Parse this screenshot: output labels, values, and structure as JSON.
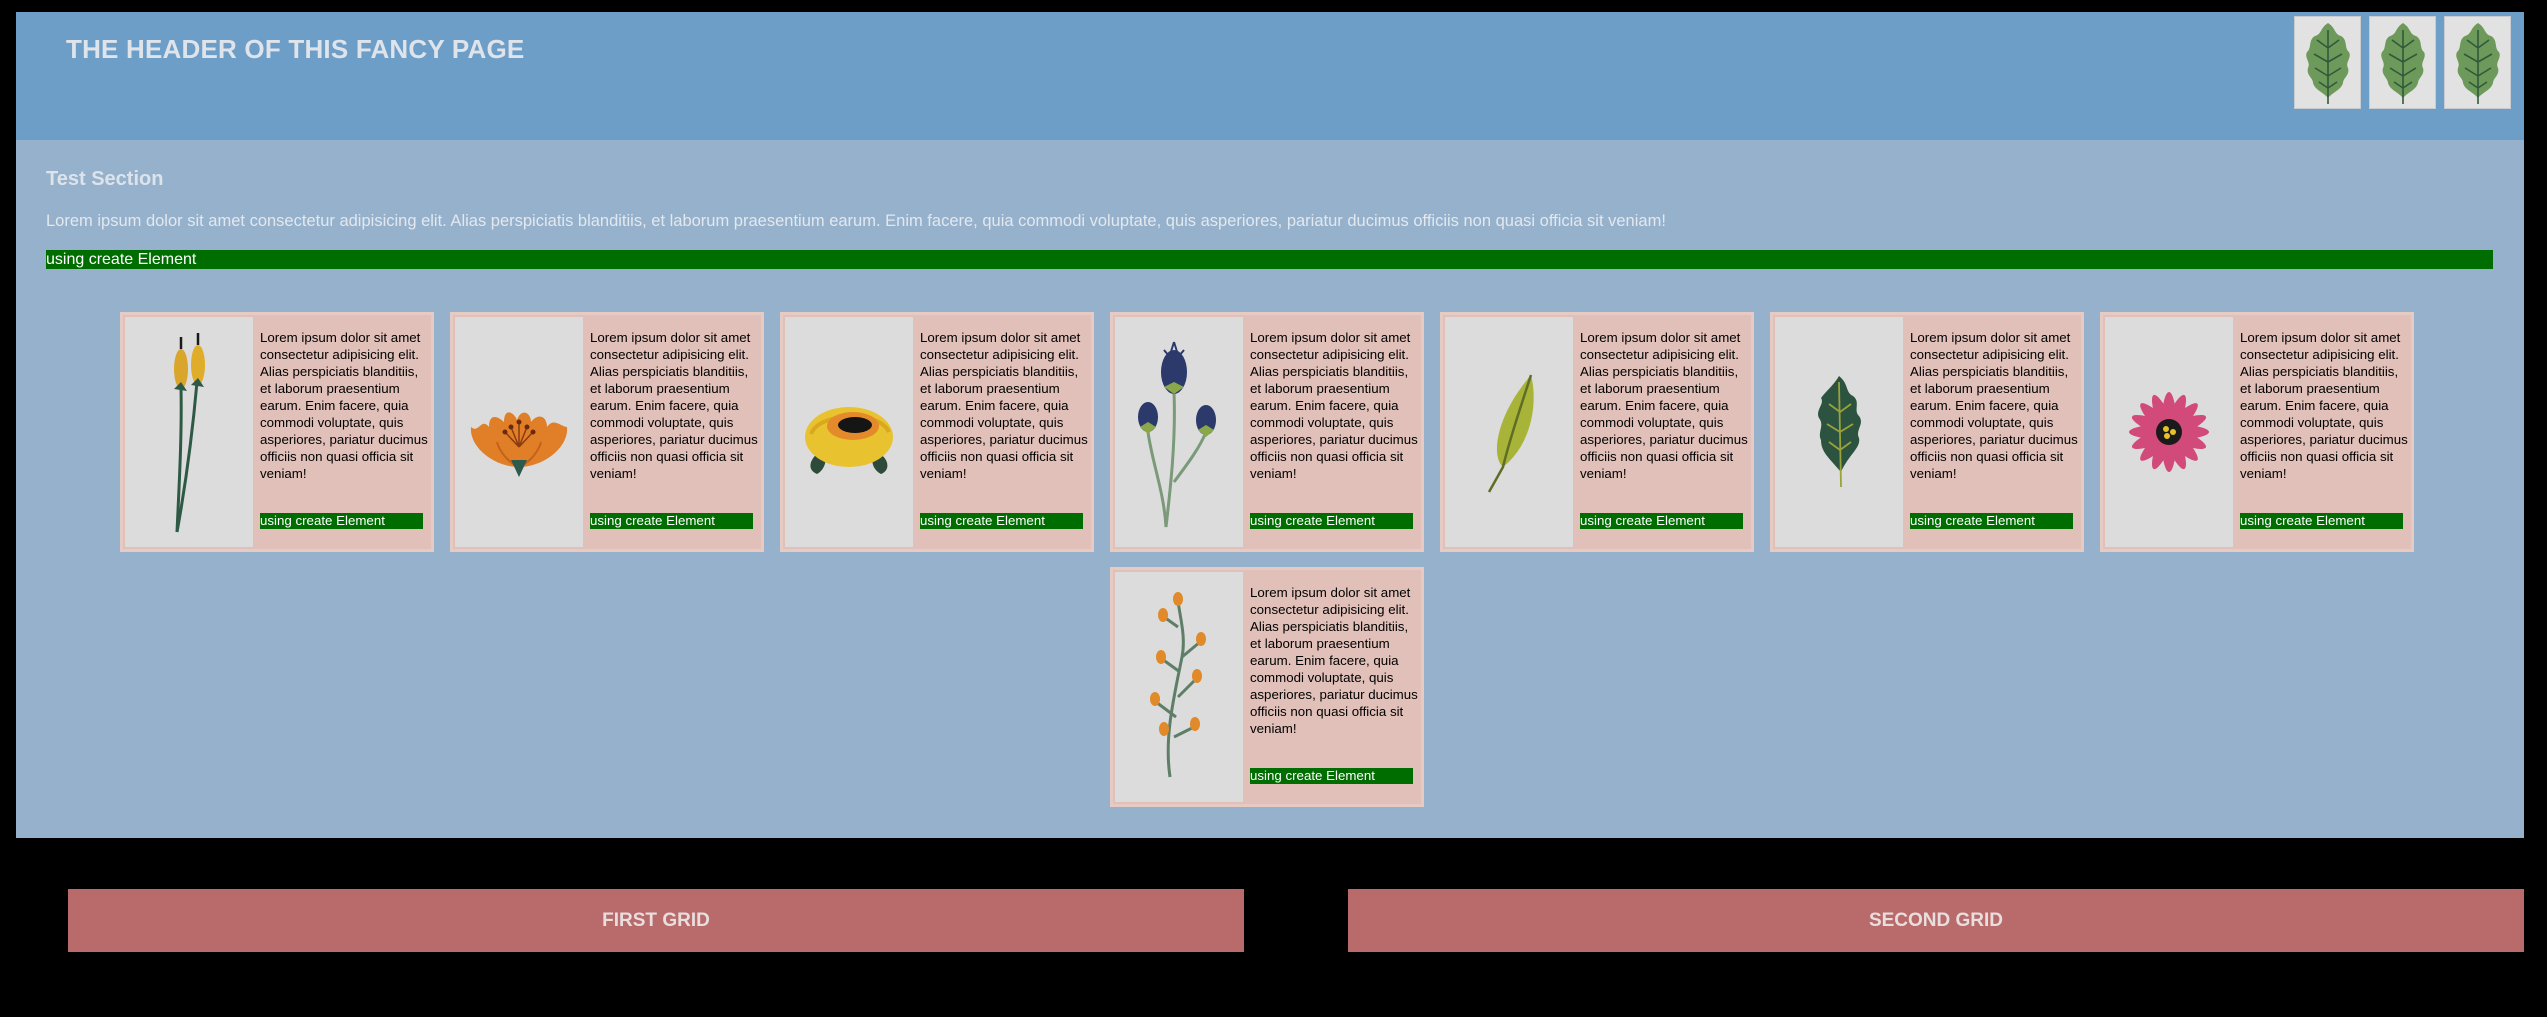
{
  "header": {
    "title": "THE HEADER OF THIS FANCY PAGE",
    "icons": [
      "leaf-icon",
      "leaf-icon",
      "leaf-icon"
    ]
  },
  "section": {
    "title": "Test Section",
    "text": "Lorem ipsum dolor sit amet consectetur adipisicing elit. Alias perspiciatis blanditiis, et laborum praesentium earum. Enim facere, quia commodi voluptate, quis asperiores, pariatur ducimus officiis non quasi officia sit veniam!",
    "bar_label": "using create Element"
  },
  "cards": [
    {
      "icon": "cattail-flower-icon",
      "text": "Lorem ipsum dolor sit amet consectetur adipisicing elit. Alias perspiciatis blanditiis, et laborum praesentium earum. Enim facere, quia commodi voluptate, quis asperiores, pariatur ducimus officiis non quasi officia sit veniam!",
      "button": "using create Element"
    },
    {
      "icon": "orange-flower-icon",
      "text": "Lorem ipsum dolor sit amet consectetur adipisicing elit. Alias perspiciatis blanditiis, et laborum praesentium earum. Enim facere, quia commodi voluptate, quis asperiores, pariatur ducimus officiis non quasi officia sit veniam!",
      "button": "using create Element"
    },
    {
      "icon": "yellow-flower-icon",
      "text": "Lorem ipsum dolor sit amet consectetur adipisicing elit. Alias perspiciatis blanditiis, et laborum praesentium earum. Enim facere, quia commodi voluptate, quis asperiores, pariatur ducimus officiis non quasi officia sit veniam!",
      "button": "using create Element"
    },
    {
      "icon": "thistle-flower-icon",
      "text": "Lorem ipsum dolor sit amet consectetur adipisicing elit. Alias perspiciatis blanditiis, et laborum praesentium earum. Enim facere, quia commodi voluptate, quis asperiores, pariatur ducimus officiis non quasi officia sit veniam!",
      "button": "using create Element"
    },
    {
      "icon": "green-leaf-icon",
      "text": "Lorem ipsum dolor sit amet consectetur adipisicing elit. Alias perspiciatis blanditiis, et laborum praesentium earum. Enim facere, quia commodi voluptate, quis asperiores, pariatur ducimus officiis non quasi officia sit veniam!",
      "button": "using create Element"
    },
    {
      "icon": "dark-leaf-icon",
      "text": "Lorem ipsum dolor sit amet consectetur adipisicing elit. Alias perspiciatis blanditiis, et laborum praesentium earum. Enim facere, quia commodi voluptate, quis asperiores, pariatur ducimus officiis non quasi officia sit veniam!",
      "button": "using create Element"
    },
    {
      "icon": "pink-flower-icon",
      "text": "Lorem ipsum dolor sit amet consectetur adipisicing elit. Alias perspiciatis blanditiis, et laborum praesentium earum. Enim facere, quia commodi voluptate, quis asperiores, pariatur ducimus officiis non quasi officia sit veniam!",
      "button": "using create Element"
    },
    {
      "icon": "orange-berry-branch-icon",
      "text": "Lorem ipsum dolor sit amet consectetur adipisicing elit. Alias perspiciatis blanditiis, et laborum praesentium earum. Enim facere, quia commodi voluptate, quis asperiores, pariatur ducimus officiis non quasi officia sit veniam!",
      "button": "using create Element"
    }
  ],
  "grids": {
    "first": "FIRST GRID",
    "second": "SECOND GRID"
  },
  "colors": {
    "header_bg": "#6c9ec8",
    "section_bg": "#95b1cb",
    "button_green": "#006d00",
    "card_bg": "#e0c0b8",
    "grid_button": "#b96b6b"
  }
}
